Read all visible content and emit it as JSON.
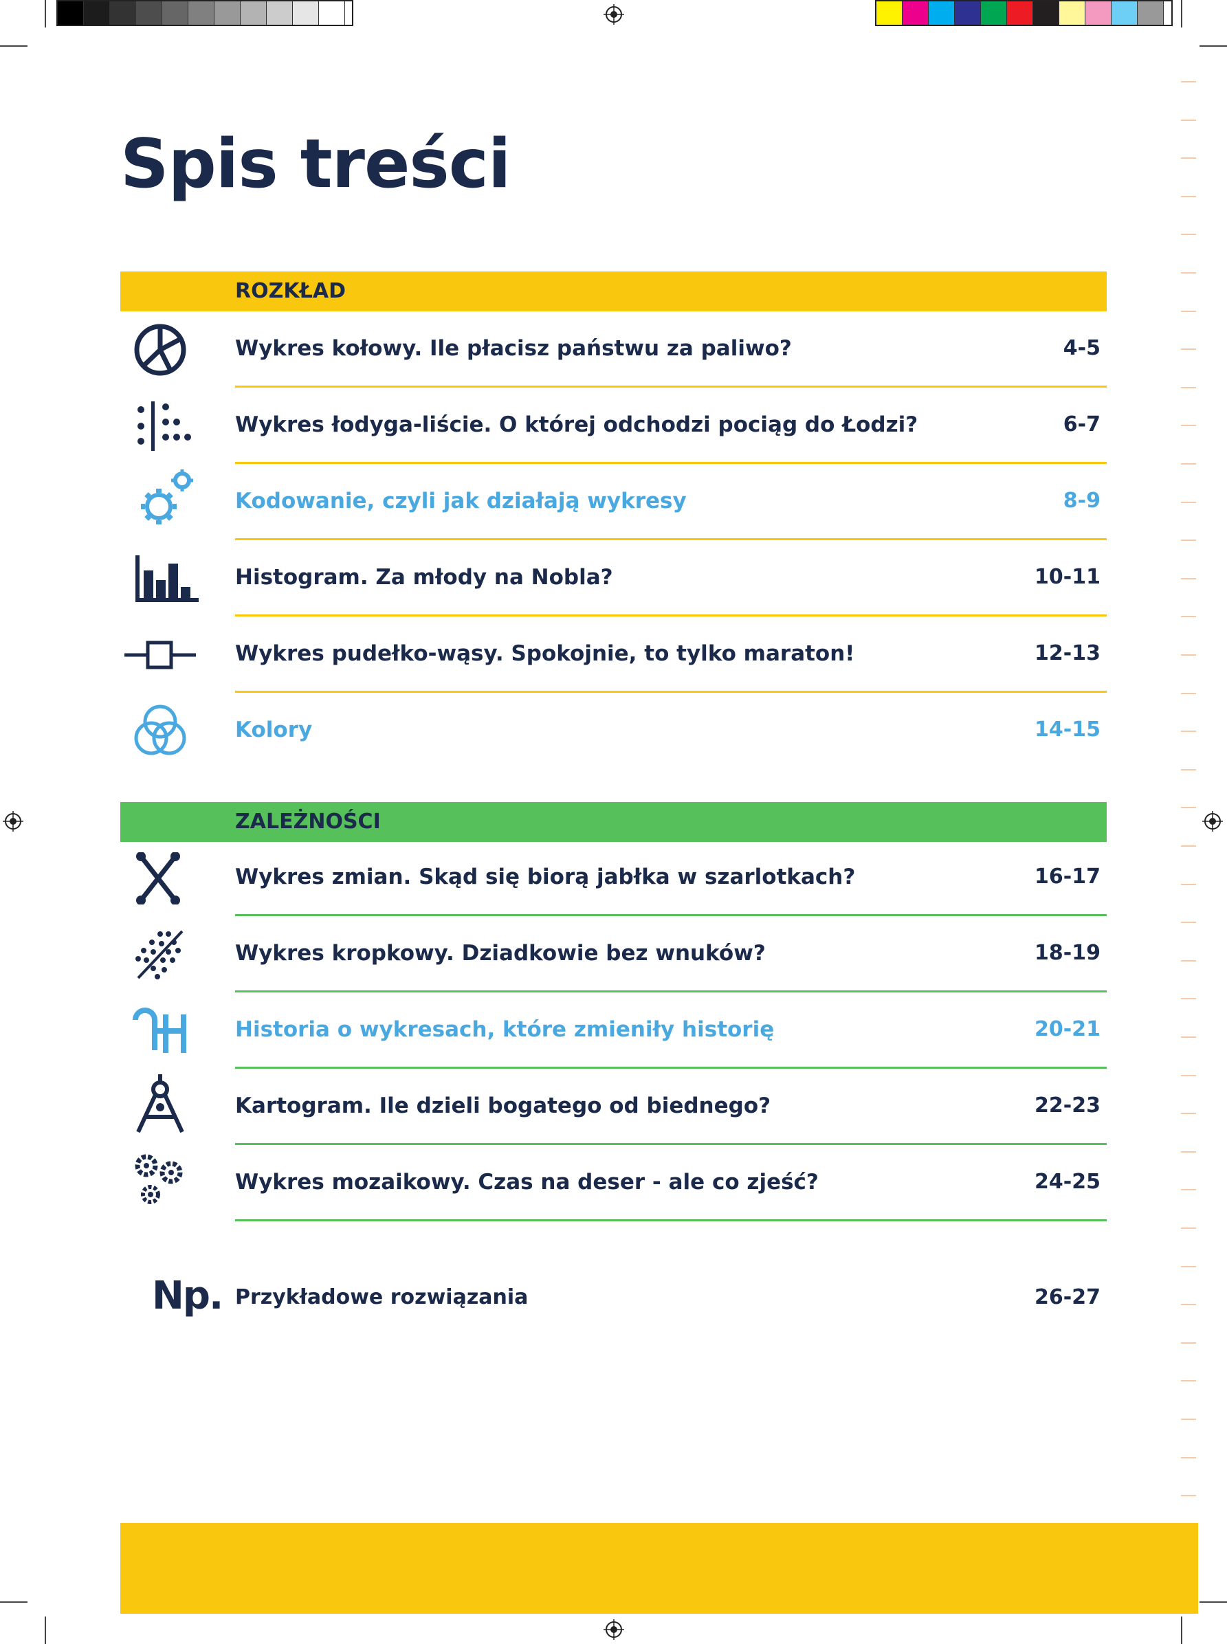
{
  "page": {
    "title": "Spis treści"
  },
  "colors": {
    "navy": "#1b2a4a",
    "yellow": "#f9c80e",
    "green": "#56c15b",
    "blue_accent": "#4aa8e0"
  },
  "sections": [
    {
      "label": "ROZKŁAD",
      "entries": [
        {
          "icon": "pie-chart-icon",
          "title": "Wykres kołowy. Ile płacisz państwu za paliwo?",
          "pages": "4-5"
        },
        {
          "icon": "stem-leaf-dots-icon",
          "title": "Wykres łodyga-liście. O której odchodzi pociąg do Łodzi?",
          "pages": "6-7"
        },
        {
          "icon": "gears-icon",
          "title": "Kodowanie, czyli jak działają wykresy",
          "pages": "8-9",
          "accent": true
        },
        {
          "icon": "histogram-icon",
          "title": "Histogram. Za młody na Nobla?",
          "pages": "10-11"
        },
        {
          "icon": "box-whisker-icon",
          "title": "Wykres pudełko-wąsy. Spokojnie, to tylko maraton!",
          "pages": "12-13"
        },
        {
          "icon": "color-circles-icon",
          "title": "Kolory",
          "pages": "14-15",
          "accent": true
        }
      ]
    },
    {
      "label": "ZALEŻNOŚCI",
      "entries": [
        {
          "icon": "crossing-lines-icon",
          "title": "Wykres zmian. Skąd się biorą jabłka w szarlotkach?",
          "pages": "16-17"
        },
        {
          "icon": "scatter-dots-icon",
          "title": "Wykres kropkowy. Dziadkowie bez wnuków?",
          "pages": "18-19"
        },
        {
          "icon": "history-h-icon",
          "title": "Historia o wykresach, które zmieniły historię",
          "pages": "20-21",
          "accent": true
        },
        {
          "icon": "compass-icon",
          "title": "Kartogram. Ile dzieli bogatego od biednego?",
          "pages": "22-23"
        },
        {
          "icon": "mosaic-circles-icon",
          "title": "Wykres mozaikowy. Czas na deser - ale co zjeść?",
          "pages": "24-25"
        }
      ]
    }
  ],
  "extra": {
    "icon_text": "Np.",
    "title": "Przykładowe rozwiązania",
    "pages": "26-27"
  }
}
